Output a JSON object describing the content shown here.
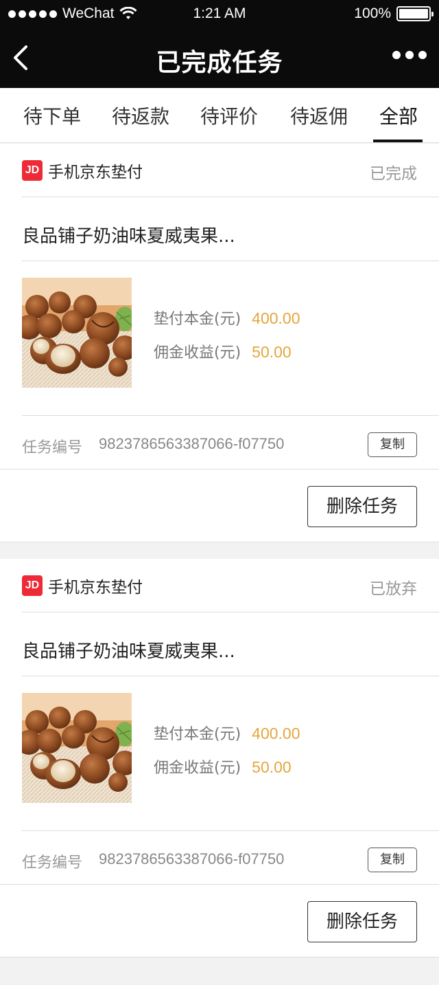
{
  "status_bar": {
    "carrier": "WeChat",
    "time": "1:21 AM",
    "battery": "100%"
  },
  "nav": {
    "title": "已完成任务"
  },
  "tabs": [
    {
      "label": "待下单"
    },
    {
      "label": "待返款"
    },
    {
      "label": "待评价"
    },
    {
      "label": "待返佣"
    },
    {
      "label": "全部"
    }
  ],
  "orders": [
    {
      "logo": "JD",
      "shop": "手机京东垫付",
      "status": "已完成",
      "title": "良品铺子奶油味夏威夷果...",
      "principal_label": "垫付本金(元)",
      "principal": "400.00",
      "commission_label": "佣金收益(元)",
      "commission": "50.00",
      "task_label": "任务编号",
      "task_id": "9823786563387066-f07750",
      "copy_label": "复制",
      "delete_label": "删除任务"
    },
    {
      "logo": "JD",
      "shop": "手机京东垫付",
      "status": "已放弃",
      "title": "良品铺子奶油味夏威夷果...",
      "principal_label": "垫付本金(元)",
      "principal": "400.00",
      "commission_label": "佣金收益(元)",
      "commission": "50.00",
      "task_label": "任务编号",
      "task_id": "9823786563387066-f07750",
      "copy_label": "复制",
      "delete_label": "删除任务"
    }
  ],
  "colors": {
    "bar_bg": "#0b0b0b",
    "jd_red": "#ee2a36",
    "amount": "#e4a63c"
  },
  "icons": {
    "back": "chevron-left-icon",
    "more": "more-dots-icon",
    "wifi": "wifi-icon",
    "battery": "battery-icon"
  }
}
